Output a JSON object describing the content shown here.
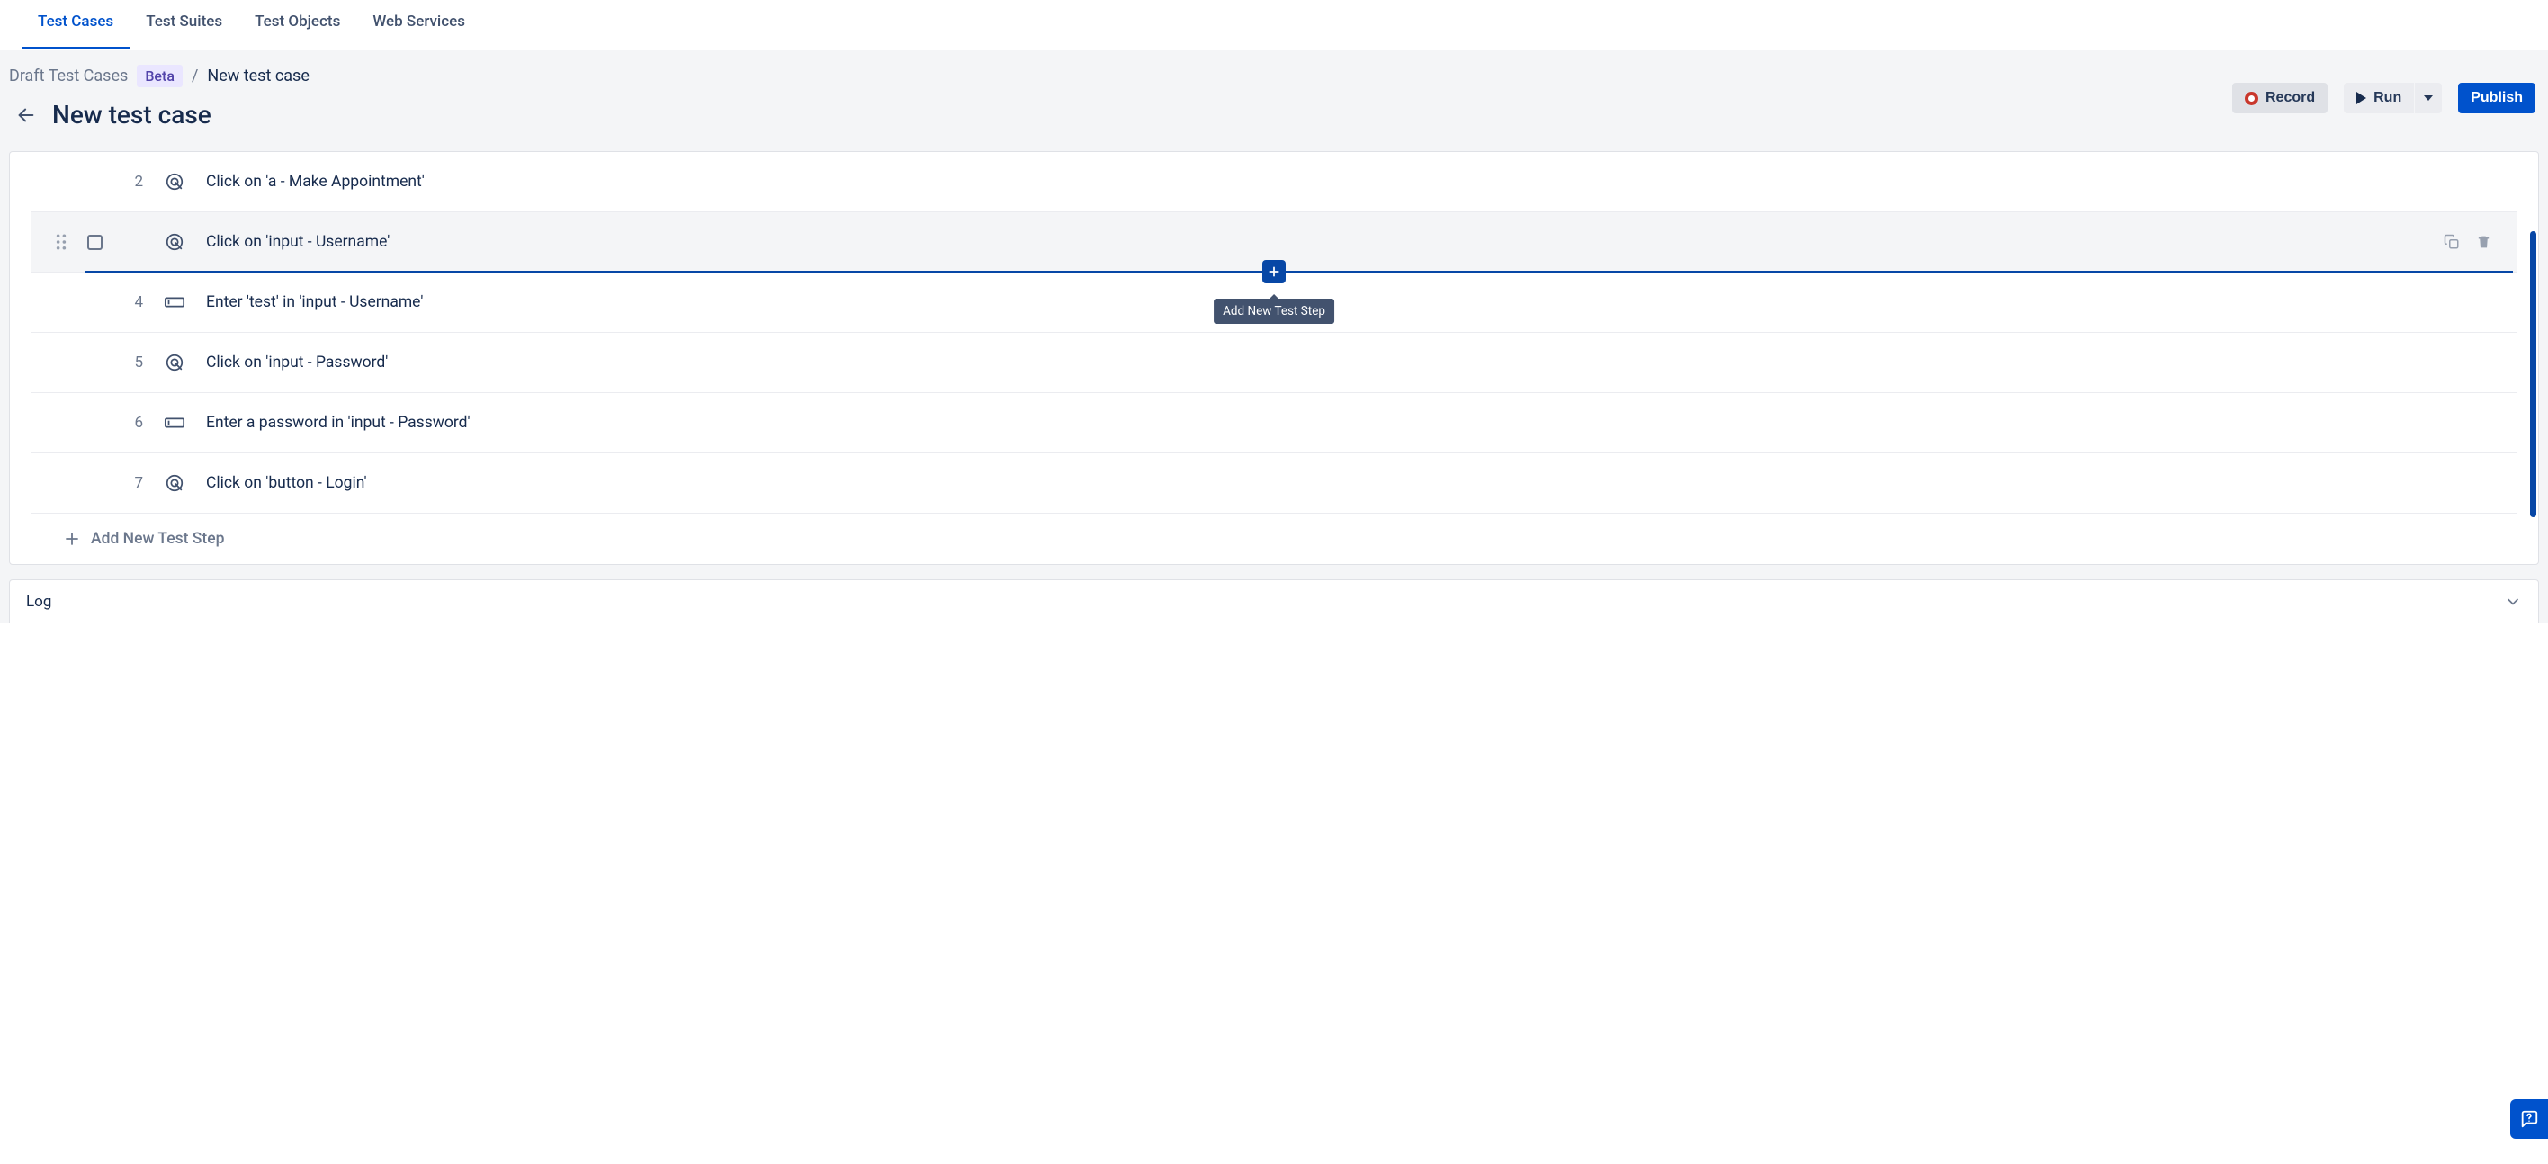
{
  "tabs": {
    "test_cases": "Test Cases",
    "test_suites": "Test Suites",
    "test_objects": "Test Objects",
    "web_services": "Web Services"
  },
  "breadcrumb": {
    "root": "Draft Test Cases",
    "badge": "Beta",
    "separator": "/",
    "current": "New test case"
  },
  "page_title": "New test case",
  "actions": {
    "record": "Record",
    "run": "Run",
    "publish": "Publish"
  },
  "steps": [
    {
      "num": "2",
      "icon": "pointer",
      "text": "Click on 'a - Make Appointment'"
    },
    {
      "num": "",
      "icon": "pointer",
      "text": "Click on 'input - Username'",
      "hovered": true
    },
    {
      "num": "4",
      "icon": "input",
      "text": "Enter 'test' in 'input - Username'"
    },
    {
      "num": "5",
      "icon": "pointer",
      "text": "Click on 'input - Password'"
    },
    {
      "num": "6",
      "icon": "input",
      "text": "Enter a password in 'input - Password'"
    },
    {
      "num": "7",
      "icon": "pointer",
      "text": "Click on 'button - Login'"
    }
  ],
  "insert_tooltip": "Add New Test Step",
  "add_step_label": "Add New Test Step",
  "log_label": "Log"
}
